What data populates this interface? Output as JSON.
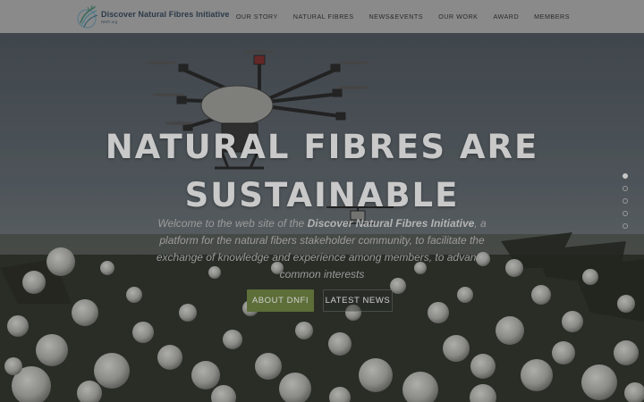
{
  "site": {
    "name": "Discover Natural Fibres Initiative",
    "subtitle": "DNFI.org"
  },
  "nav": {
    "items": [
      {
        "label": "OUR STORY"
      },
      {
        "label": "NATURAL FIBRES"
      },
      {
        "label": "NEWS&EVENTS"
      },
      {
        "label": "OUR WORK"
      },
      {
        "label": "AWARD"
      },
      {
        "label": "MEMBERS"
      }
    ]
  },
  "hero": {
    "title_line1": "NATURAL FIBRES ARE",
    "title_line2": "SUSTAINABLE",
    "text_before": "Welcome to the web site of the ",
    "text_bold": "Discover Natural Fibres Initiative",
    "text_after": ", a platform for the natural fibers stakeholder community, to facilitate the exchange of knowledge and experience among members, to advance common interests",
    "primary_button": "ABOUT DNFI",
    "secondary_button": "LATEST NEWS"
  },
  "slider": {
    "count": 5,
    "active_index": 0
  },
  "colors": {
    "navbar": "#8a8a8a",
    "primary_button": "#5d6e38",
    "logo_text": "#2b3a4a"
  },
  "icons": {
    "logo": "cotton-plant-logo-icon",
    "drone": "drone-illustration",
    "cotton": "cotton-boll-illustration"
  }
}
